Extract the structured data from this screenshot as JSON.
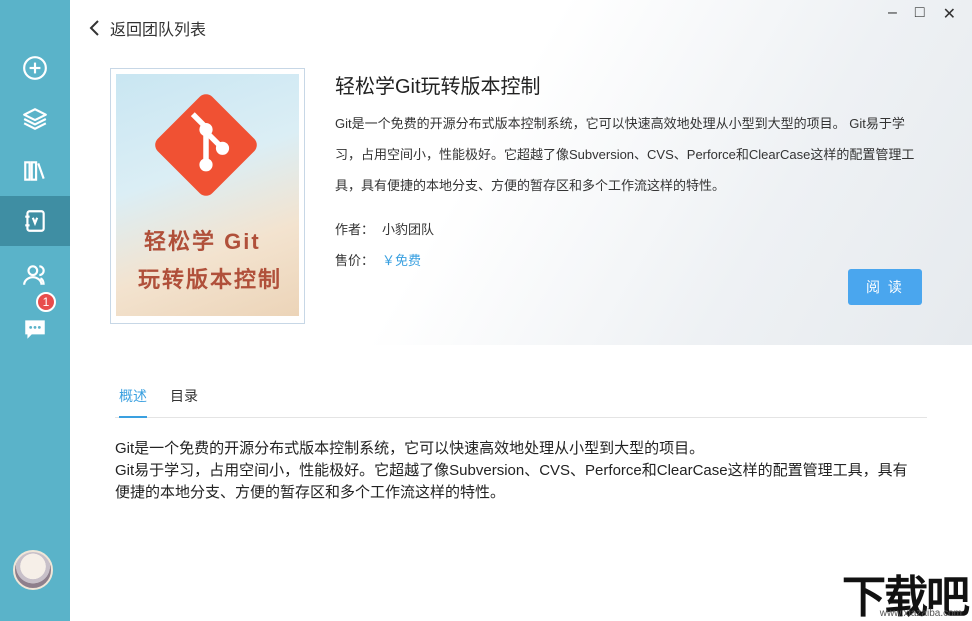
{
  "nav": {
    "back_label": "返回团队列表",
    "tooltip": "图书",
    "badge_count": "1"
  },
  "window": {
    "minimize": "–",
    "maximize": "□",
    "close": "✕"
  },
  "book": {
    "cover_line1": "轻松学 Git",
    "cover_line2": "玩转版本控制",
    "title": "轻松学Git玩转版本控制",
    "description": "Git是一个免费的开源分布式版本控制系统，它可以快速高效地处理从小型到大型的项目。 Git易于学习，占用空间小，性能极好。它超越了像Subversion、CVS、Perforce和ClearCase这样的配置管理工具，具有便捷的本地分支、方便的暂存区和多个工作流这样的特性。",
    "author_label": "作者：",
    "author": "小豹团队",
    "price_label": "售价：",
    "price": "￥免费",
    "read_button": "阅 读"
  },
  "tabs": {
    "overview": "概述",
    "toc": "目录"
  },
  "overview": {
    "line1": "Git是一个免费的开源分布式版本控制系统，它可以快速高效地处理从小型到大型的项目。",
    "line2": "Git易于学习，占用空间小，性能极好。它超越了像Subversion、CVS、Perforce和ClearCase这样的配置管理工具，具有便捷的本地分支、方便的暂存区和多个工作流这样的特性。"
  },
  "watermark": {
    "main": "下载吧",
    "sub": "www.xiazaiba.com"
  },
  "colors": {
    "sidebar": "#5ab3c9",
    "accent": "#3aa0e0",
    "git_orange": "#f05133"
  }
}
